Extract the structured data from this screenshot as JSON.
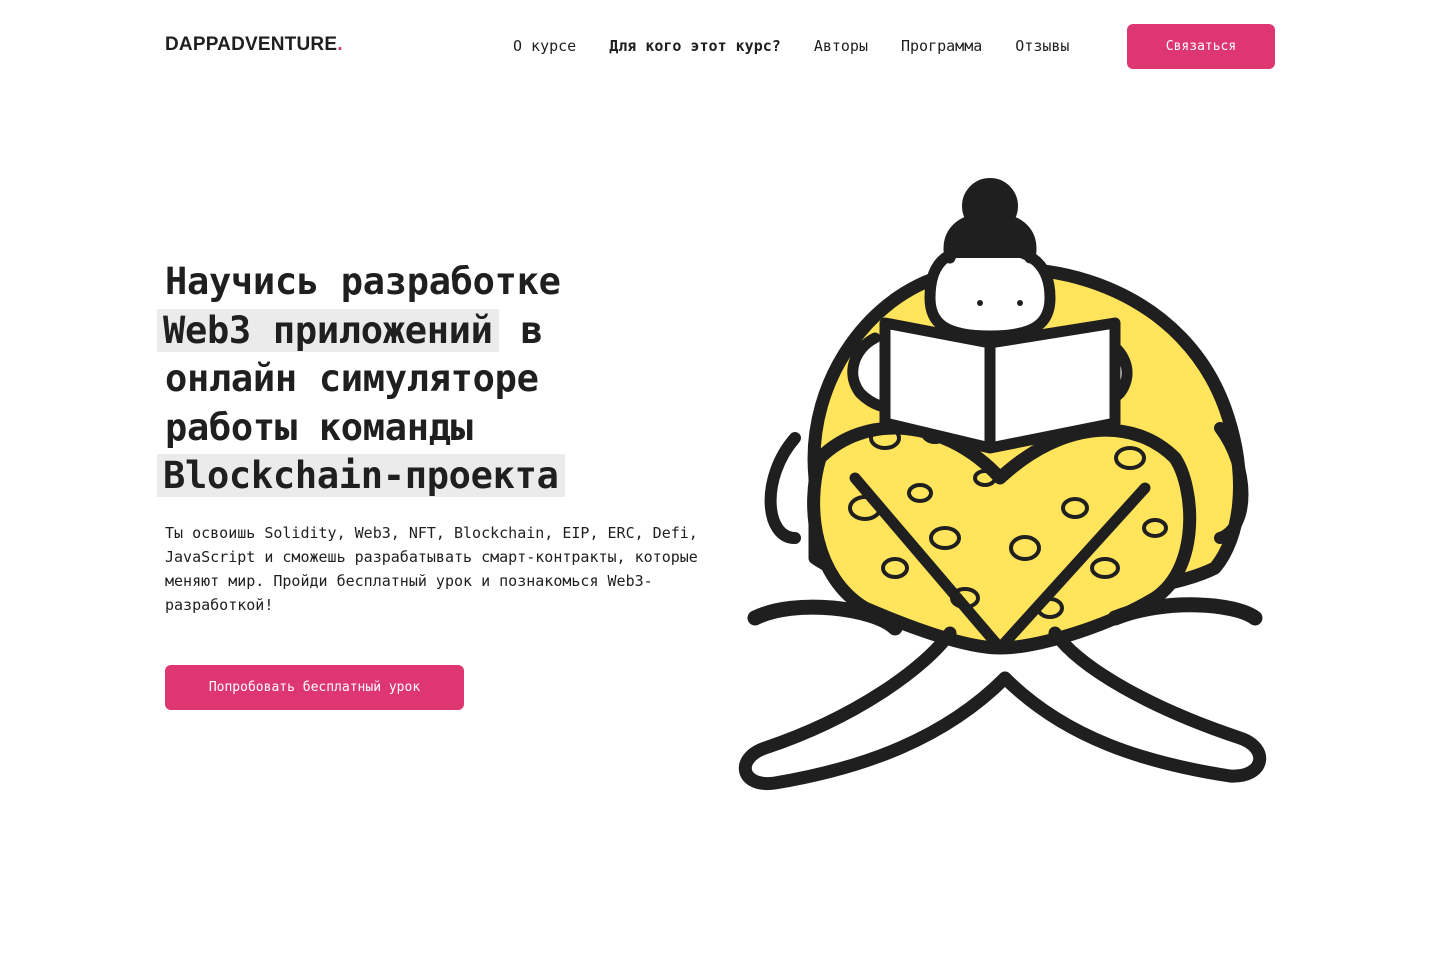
{
  "header": {
    "logo_text": "DAPPADVENTURE",
    "logo_dot": ".",
    "nav": [
      {
        "label": "О курсе",
        "active": false
      },
      {
        "label": "Для кого этот курс?",
        "active": true
      },
      {
        "label": "Авторы",
        "active": false
      },
      {
        "label": "Программа",
        "active": false
      },
      {
        "label": "Отзывы",
        "active": false
      }
    ],
    "contact_button": "Связаться"
  },
  "hero": {
    "title_lines": {
      "line1": "Научись разработке",
      "line2_highlight": "Web3 приложений",
      "line2_rest": " в",
      "line3": "онлайн симуляторе",
      "line4": "работы команды",
      "line5_highlight": "Blockchain-проекта"
    },
    "description": "Ты освоишь Solidity, Web3, NFT, Blockchain, EIP, ERC, Defi, JavaScript и сможешь разрабатывать смарт-контракты, которые меняют мир. Пройди бесплатный урок и познакомься Web3-разработкой!",
    "cta_button": "Попробовать бесплатный урок"
  },
  "colors": {
    "accent": "#dd3671",
    "highlight_bg": "#ebebeb",
    "illustration_yellow": "#ffe45c",
    "ink": "#1f1f1f"
  }
}
